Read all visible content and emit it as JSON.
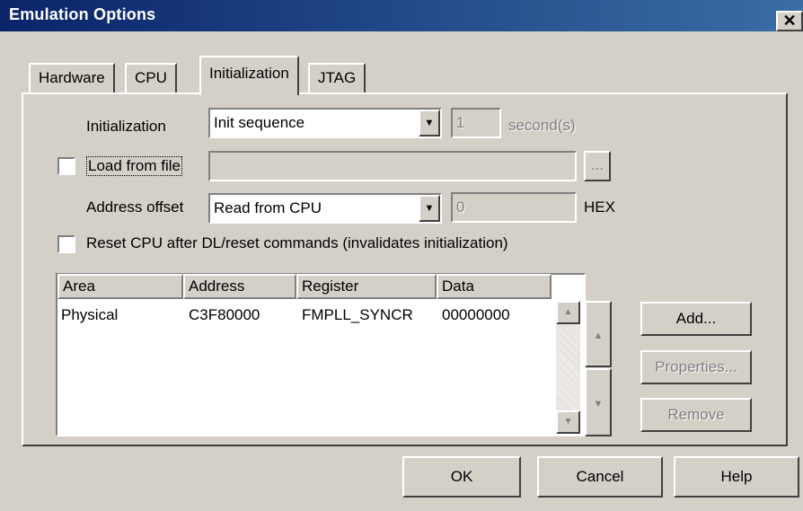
{
  "window": {
    "title": "Emulation Options",
    "close_glyph": "✕"
  },
  "tabs": [
    {
      "label": "Hardware",
      "active": false
    },
    {
      "label": "CPU",
      "active": false
    },
    {
      "label": "Initialization",
      "active": true
    },
    {
      "label": "JTAG",
      "active": false
    }
  ],
  "initialization": {
    "label": "Initialization",
    "selected": "Init sequence",
    "seconds_value": "1",
    "seconds_unit": "second(s)"
  },
  "load_from_file": {
    "label": "Load from file",
    "checked": false,
    "path": "",
    "browse_label": "..."
  },
  "address_offset": {
    "label": "Address offset",
    "selected": "Read from CPU",
    "value": "0",
    "unit": "HEX"
  },
  "reset_cpu": {
    "label": "Reset CPU after DL/reset commands (invalidates initialization)",
    "checked": false
  },
  "table": {
    "columns": [
      "Area",
      "Address",
      "Register",
      "Data"
    ],
    "rows": [
      {
        "area": "Physical",
        "address": "C3F80000",
        "register": "FMPLL_SYNCR",
        "data": "00000000"
      }
    ]
  },
  "side_buttons": {
    "add": "Add...",
    "properties": "Properties...",
    "remove": "Remove"
  },
  "footer": {
    "ok": "OK",
    "cancel": "Cancel",
    "help": "Help"
  },
  "icons": {
    "dropdown": "triangle-down",
    "move_up": "triangle-up",
    "move_down": "triangle-down"
  }
}
